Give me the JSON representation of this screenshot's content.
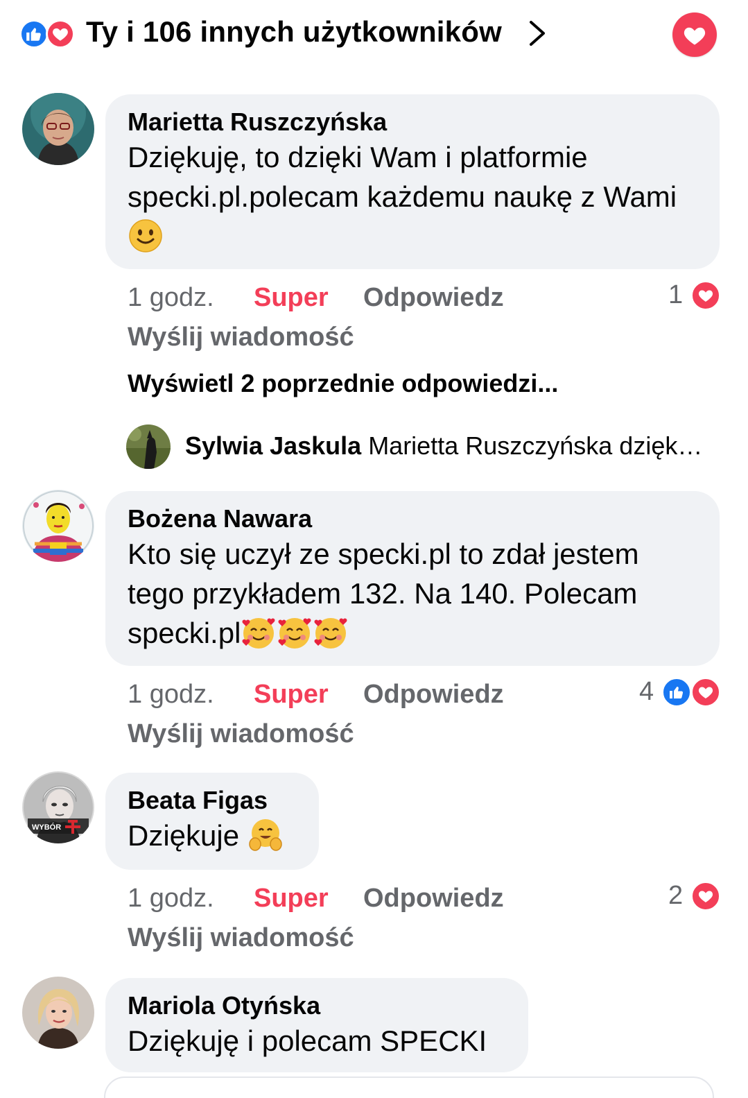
{
  "header": {
    "title": "Ty i 106 innych użytkowników",
    "reaction_icons": [
      "like-icon",
      "love-icon"
    ],
    "accent_like": "#1877f2",
    "accent_love": "#f33e58"
  },
  "comments": [
    {
      "author": "Marietta Ruszczyńska",
      "text": "Dziękuję, to dzięki Wam i platformie specki.pl.polecam każdemu naukę z Wami",
      "emoji": "slightly-smiling-face-emoji",
      "time": "1 godz.",
      "react_label": "Super",
      "reply_label": "Odpowiedz",
      "message_label": "Wyślij wiadomość",
      "reaction_count": "1",
      "reaction_types": [
        "love"
      ]
    },
    {
      "author": "Bożena Nawara",
      "text": "Kto się uczył ze specki.pl to zdał  jestem tego przykładem 132. Na 140. Polecam specki.pl",
      "emoji": "smiling-face-with-hearts-emoji",
      "time": "1 godz.",
      "react_label": "Super",
      "reply_label": "Odpowiedz",
      "message_label": "Wyślij wiadomość",
      "reaction_count": "4",
      "reaction_types": [
        "like",
        "love"
      ]
    },
    {
      "author": "Beata Figas",
      "text": "Dziękuje",
      "emoji": "hugging-face-emoji",
      "time": "1 godz.",
      "react_label": "Super",
      "reply_label": "Odpowiedz",
      "message_label": "Wyślij wiadomość",
      "reaction_count": "2",
      "reaction_types": [
        "love"
      ]
    },
    {
      "author": "Mariola Otyńska",
      "text": "Dziękuję i polecam SPECKI"
    }
  ],
  "replies_thread": {
    "view_previous": "Wyświetl 2 poprzednie odpowiedzi...",
    "reply_author": "Sylwia Jaskula",
    "reply_preview": "Marietta Ruszczyńska dzięk…"
  },
  "avatar_badge_text": "WYBÓR"
}
